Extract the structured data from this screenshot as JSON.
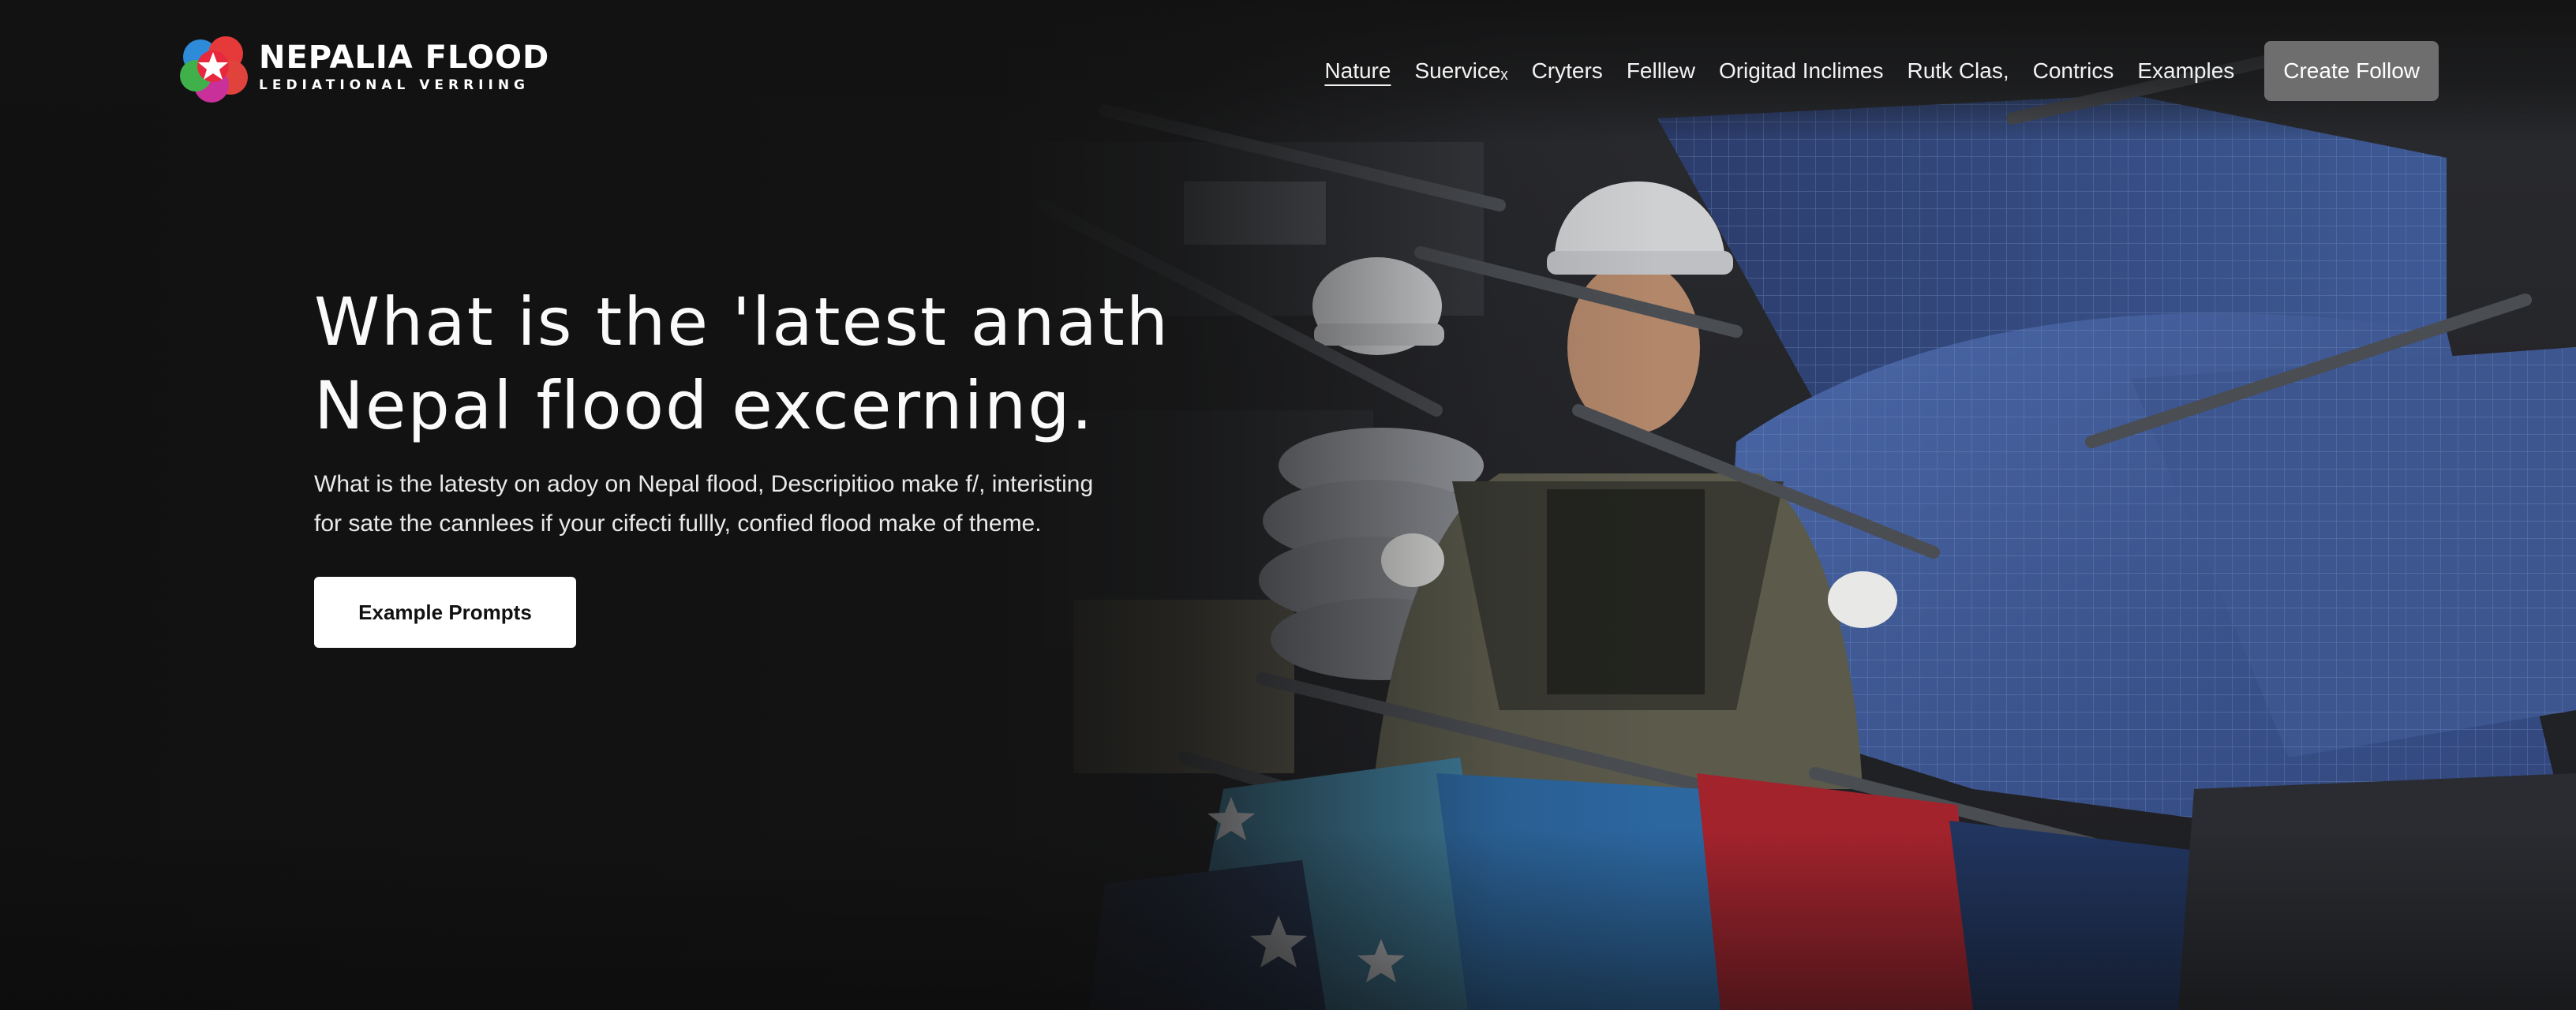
{
  "brand": {
    "title": "NEPALIA FLOOD",
    "subtitle": "LEDIATIONAL VERRIING",
    "logo_icon": "star-flower-logo-icon"
  },
  "nav": {
    "items": [
      {
        "label": "Nature",
        "active": true
      },
      {
        "label": "Suerviceₓ",
        "active": false
      },
      {
        "label": "Cryters",
        "active": false
      },
      {
        "label": "Felllew",
        "active": false
      },
      {
        "label": "Origitad Inclimes",
        "active": false
      },
      {
        "label": "Rutk Clas,",
        "active": false
      },
      {
        "label": "Contrics",
        "active": false
      },
      {
        "label": "Examples",
        "active": false
      }
    ],
    "cta_label": "Create Follow"
  },
  "hero": {
    "title_line1": "What is the 'latest anath",
    "title_line2": "Nepal flood excerning.",
    "description_line1": "What is the latesty on adoy on Nepal flood, Descripitioo make f/, interisting",
    "description_line2": "for sate the cannlees if your cifecti fullly, confied flood make of theme.",
    "button_label": "Example Prompts"
  },
  "colors": {
    "background": "#121212",
    "cta_background": "#6e6e6e",
    "button_background": "#ffffff",
    "panel_blue": "#3f5c97"
  }
}
